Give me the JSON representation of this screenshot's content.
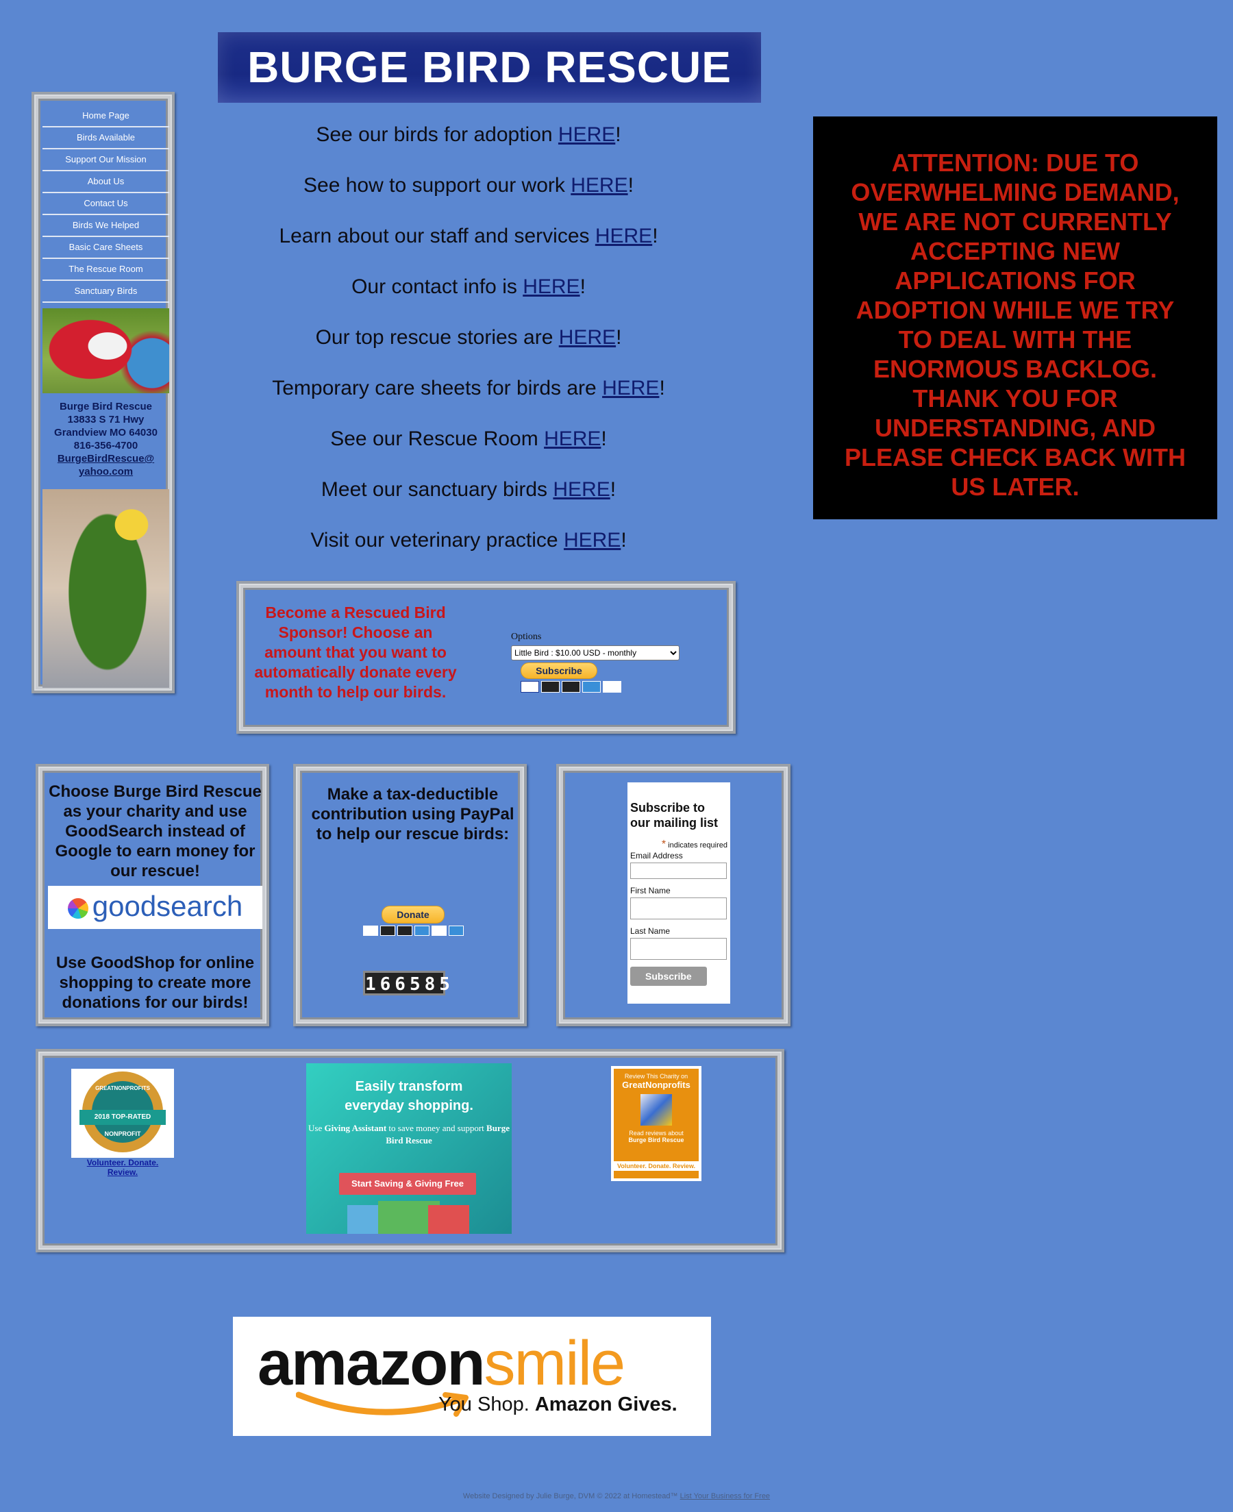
{
  "header": {
    "title": "BURGE BIRD RESCUE"
  },
  "sidebar": {
    "items": [
      {
        "label": "Home Page"
      },
      {
        "label": "Birds Available"
      },
      {
        "label": "Support Our Mission"
      },
      {
        "label": "About Us"
      },
      {
        "label": "Contact Us"
      },
      {
        "label": "Birds We Helped"
      },
      {
        "label": "Basic Care Sheets"
      },
      {
        "label": "The Rescue Room"
      },
      {
        "label": "Sanctuary Birds"
      }
    ],
    "contact": {
      "name": "Burge Bird Rescue",
      "address": "13833 S 71 Hwy",
      "city": "Grandview MO 64030",
      "phone": "816-356-4700",
      "email_line1": "BurgeBirdRescue@",
      "email_line2": "yahoo.com"
    }
  },
  "links": [
    {
      "text": "See our birds for adoption ",
      "link": "HERE",
      "suffix": "!"
    },
    {
      "text": "See how to support our work ",
      "link": "HERE",
      "suffix": "!"
    },
    {
      "text": "Learn about our staff and services ",
      "link": "HERE",
      "suffix": "!"
    },
    {
      "text": "Our contact info is ",
      "link": "HERE",
      "suffix": "!"
    },
    {
      "text": "Our top rescue stories are ",
      "link": "HERE",
      "suffix": "!"
    },
    {
      "text": "Temporary care sheets for birds are ",
      "link": "HERE",
      "suffix": "!"
    },
    {
      "text": "See our Rescue Room ",
      "link": "HERE",
      "suffix": "!"
    },
    {
      "text": "Meet our sanctuary birds ",
      "link": "HERE",
      "suffix": "!"
    },
    {
      "text": "Visit our veterinary practice ",
      "link": "HERE",
      "suffix": "!"
    }
  ],
  "attention": {
    "text": "ATTENTION: DUE TO OVERWHELMING DEMAND, WE ARE NOT CURRENTLY ACCEPTING NEW APPLICATIONS FOR ADOPTION WHILE WE TRY TO DEAL WITH THE ENORMOUS BACKLOG. THANK YOU FOR UNDERSTANDING, AND PLEASE CHECK BACK WITH US LATER."
  },
  "sponsor": {
    "text": "Become a Rescued Bird Sponsor! Choose an amount that you want to automatically donate every month to help our birds.",
    "options_label": "Options",
    "selected_option": "Little Bird : $10.00 USD - monthly",
    "subscribe_label": "Subscribe"
  },
  "goodsearch": {
    "title": "Choose Burge Bird Rescue as your charity and use GoodSearch instead of Google to earn money for our rescue!",
    "logo_text": "goodsearch",
    "shop_text": "Use GoodShop for online shopping to create more donations for our birds!"
  },
  "paypal": {
    "title": "Make a tax-deductible contribution using PayPal to help our rescue birds:",
    "donate_label": "Donate",
    "counter": "166585"
  },
  "mailing": {
    "title": "Subscribe to our mailing list",
    "required_star": "*",
    "required_note": "indicates required",
    "email_label": "Email Address",
    "first_label": "First Name",
    "last_label": "Last Name",
    "subscribe_label": "Subscribe"
  },
  "badges": {
    "gnp_top": "GREATNONPROFITS",
    "gnp_ribbon": "2018 TOP-RATED",
    "gnp_bottom": "NONPROFIT",
    "gnp_caption": "Volunteer. Donate. Review.",
    "ga_head_1": "Easily transform",
    "ga_head_2": "everyday shopping.",
    "ga_text_pre": "Use ",
    "ga_text_brand": "Giving Assistant",
    "ga_text_mid": " to save money and support ",
    "ga_text_org": "Burge Bird Rescue",
    "ga_button": "Start Saving & Giving Free",
    "gnp2_review": "Review This Charity on",
    "gnp2_brand": "GreatNonprofits",
    "gnp2_read": "Read reviews about",
    "gnp2_org": "Burge Bird Rescue",
    "gnp2_footer": "Volunteer. Donate. Review."
  },
  "amazon": {
    "word1": "amazon",
    "word2": "smile",
    "tag_pre": "You Shop. ",
    "tag_bold": "Amazon Gives."
  },
  "footer": {
    "text": "Website Designed by Julie Burge, DVM © 2022 at Homestead™ ",
    "link": "List Your Business for Free"
  },
  "colors": {
    "background": "#5b87d1",
    "banner": "#182983",
    "alert_text": "#c81f10",
    "sponsor_text": "#c8171a"
  }
}
